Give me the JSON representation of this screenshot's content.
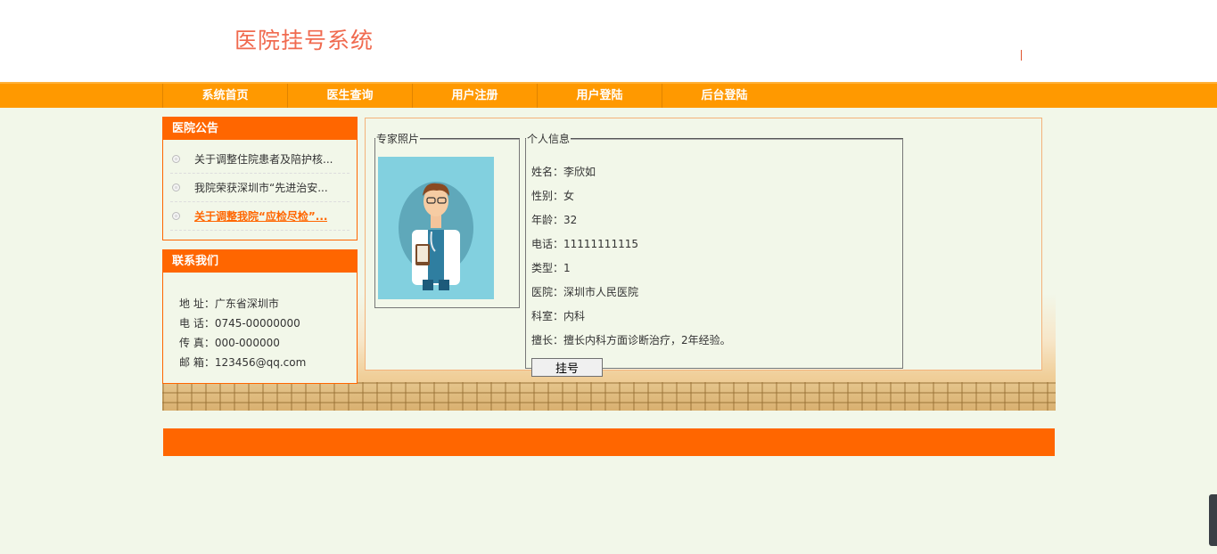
{
  "header": {
    "title": "医院挂号系统"
  },
  "nav": {
    "items": [
      {
        "label": "系统首页"
      },
      {
        "label": "医生查询"
      },
      {
        "label": "用户注册"
      },
      {
        "label": "用户登陆"
      },
      {
        "label": "后台登陆"
      }
    ]
  },
  "notice": {
    "title": "医院公告",
    "items": [
      {
        "label": "关于调整住院患者及陪护核..."
      },
      {
        "label": "我院荣获深圳市“先进治安..."
      },
      {
        "label": "关于调整我院“应检尽检”..."
      }
    ]
  },
  "contact": {
    "title": "联系我们",
    "rows": [
      "地 址：广东省深圳市",
      "电 话：0745-00000000",
      "传 真：000-000000",
      "邮 箱：123456@qq.com"
    ]
  },
  "doctor": {
    "photo_legend": "专家照片",
    "info_legend": "个人信息",
    "rows": [
      "姓名：李欣如",
      "性别：女",
      "年龄：32",
      "电话：11111111115",
      "类型：1",
      "医院：深圳市人民医院",
      "科室：内科",
      "擅长：擅长内科方面诊断治疗，2年经验。"
    ],
    "register_label": "挂号"
  },
  "colors": {
    "nav": "#ff9900",
    "accent": "#ff6600",
    "title": "#f06a4f",
    "background": "#f2f7e9"
  }
}
